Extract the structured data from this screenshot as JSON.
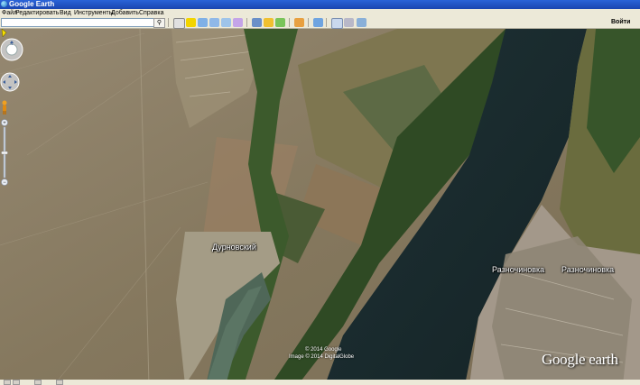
{
  "window": {
    "title": "Google Earth"
  },
  "menu": [
    "Файл",
    "Редактировать",
    "Вид",
    "Инструменты",
    "Добавить",
    "Справка"
  ],
  "search": {
    "value": "",
    "placeholder": ""
  },
  "toolbar": {
    "buttons": [
      "hide-sidebar-icon",
      "placemark-icon",
      "polygon-icon",
      "path-icon",
      "image-overlay-icon",
      "record-tour-icon",
      "historical-imagery-icon",
      "sun-icon",
      "planets-icon",
      "ruler-icon",
      "email-icon",
      "print-icon",
      "save-image-icon",
      "view-in-maps-icon"
    ],
    "login_label": "Войти"
  },
  "map": {
    "places": [
      {
        "name": "Дурновский"
      },
      {
        "name": "Разночиновка"
      },
      {
        "name": "Разночиновка"
      }
    ],
    "copyright": [
      "© 2014 Google",
      "Image © 2014 DigitalGlobe"
    ],
    "logo": "Google earth"
  },
  "colors": {
    "titlebar": "#2a63d8",
    "river": "#182a2c",
    "desert": "#8a7c62",
    "label_text": "#ffffff",
    "pin": "#f5e000"
  }
}
